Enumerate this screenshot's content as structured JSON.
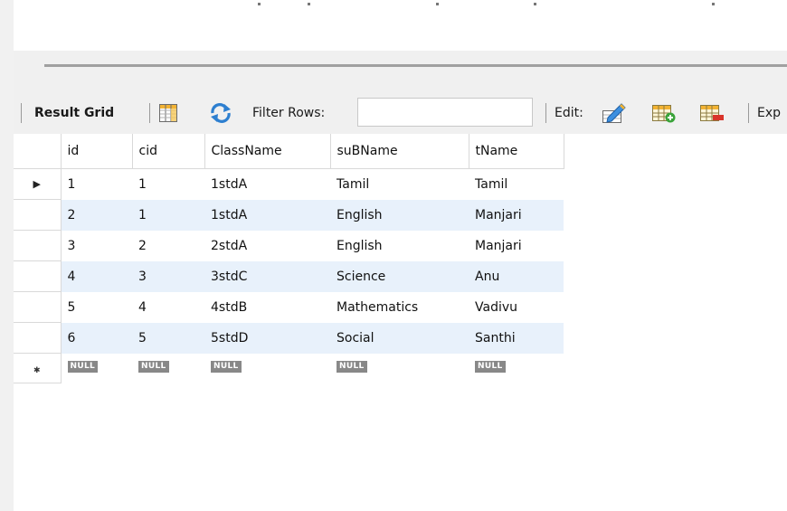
{
  "toolbar": {
    "result_grid_label": "Result Grid",
    "filter_label": "Filter Rows:",
    "filter_value": "",
    "edit_label": "Edit:",
    "export_label": "Exp",
    "icons": [
      "grid-layout-icon",
      "refresh-icon",
      "edit-pencil-icon",
      "add-row-icon",
      "delete-row-icon"
    ]
  },
  "grid": {
    "columns": [
      "id",
      "cid",
      "ClassName",
      "suBName",
      "tName"
    ],
    "rows": [
      [
        "1",
        "1",
        "1stdA",
        "Tamil",
        "Tamil"
      ],
      [
        "2",
        "1",
        "1stdA",
        "English",
        "Manjari"
      ],
      [
        "3",
        "2",
        "2stdA",
        "English",
        "Manjari"
      ],
      [
        "4",
        "3",
        "3stdC",
        "Science",
        "Anu"
      ],
      [
        "5",
        "4",
        "4stdB",
        "Mathematics",
        "Vadivu"
      ],
      [
        "6",
        "5",
        "5stdD",
        "Social",
        "Santhi"
      ]
    ],
    "null_label": "NULL",
    "current_row_marker": "▶",
    "new_row_marker": "✱"
  },
  "colors": {
    "stripe": "#e8f1fb",
    "toolbar_bg": "#f0f0f0",
    "null_badge": "#888888"
  }
}
